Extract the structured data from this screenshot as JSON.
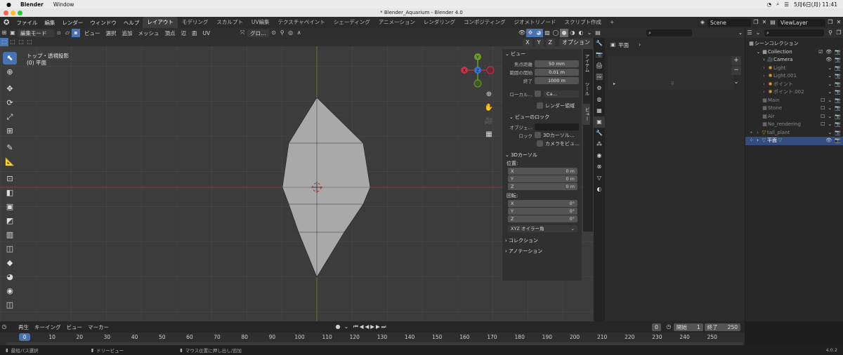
{
  "mac": {
    "app": "Blender",
    "menu": [
      "Window"
    ],
    "clock": "5月6日(月) 11:41"
  },
  "window": {
    "title": "* Blender_Aquarium - Blender 4.0"
  },
  "menubar": {
    "items": [
      "ファイル",
      "編集",
      "レンダー",
      "ウィンドウ",
      "ヘルプ"
    ],
    "workspaces": [
      "レイアウト",
      "モデリング",
      "スカルプト",
      "UV編集",
      "テクスチャペイント",
      "シェーディング",
      "アニメーション",
      "レンダリング",
      "コンポジティング",
      "ジオメトリノード",
      "スクリプト作成"
    ],
    "add_ws": "+",
    "scene": "Scene",
    "viewlayer": "ViewLayer"
  },
  "viewport": {
    "mode": "編集モード",
    "menus": [
      "ビュー",
      "選択",
      "追加",
      "メッシュ",
      "頂点",
      "辺",
      "面",
      "UV"
    ],
    "transform": "グロ…",
    "overlay_label": "オプション",
    "xyz": [
      "X",
      "Y",
      "Z"
    ],
    "info_line1": "トップ・透視投影",
    "info_line2": "(0) 平面",
    "gizmo": {
      "y": "Y",
      "x": "X",
      "z": "Z"
    }
  },
  "npanel": {
    "view_header": "ビュー",
    "focal_label": "焦点距離",
    "focal_value": "50 mm",
    "clip_start_label": "範囲の開始",
    "clip_start_value": "0.01 m",
    "clip_end_label": "終了",
    "clip_end_value": "1000 m",
    "local_label": "ローカル…",
    "local_value": "Ca…",
    "render_region": "レンダー領域",
    "lock_header": "ビューのロック",
    "obj_label": "オブジェ…",
    "lock_label": "ロック",
    "lock_3d": "3Dカーソル…",
    "lock_cam": "カメラをビュ…",
    "cursor_header": "3Dカーソル",
    "loc_label": "位置:",
    "loc": [
      {
        "axis": "X",
        "val": "0 m"
      },
      {
        "axis": "Y",
        "val": "0 m"
      },
      {
        "axis": "Z",
        "val": "0 m"
      }
    ],
    "rot_label": "回転:",
    "rot": [
      {
        "axis": "X",
        "val": "0°"
      },
      {
        "axis": "Y",
        "val": "0°"
      },
      {
        "axis": "Z",
        "val": "0°"
      }
    ],
    "rot_mode": "XYZ オイラー角",
    "collection_header": "コレクション",
    "annotation_header": "アノテーション",
    "tabs": [
      "アイテム",
      "ツール",
      "ビュー"
    ]
  },
  "properties": {
    "object": "平面"
  },
  "outliner": {
    "root": "シーンコレクション",
    "rows": [
      {
        "name": "Collection",
        "depth": 0
      },
      {
        "name": "Camera",
        "depth": 1
      },
      {
        "name": "Light",
        "depth": 1
      },
      {
        "name": "Light.001",
        "depth": 1
      },
      {
        "name": "ポイント",
        "depth": 1
      },
      {
        "name": "ポイント.002",
        "depth": 1
      },
      {
        "name": "Main",
        "depth": 0
      },
      {
        "name": "Stone",
        "depth": 0
      },
      {
        "name": "Air",
        "depth": 0
      },
      {
        "name": "No_rendering",
        "depth": 0
      },
      {
        "name": "tall_plant",
        "depth": 0
      },
      {
        "name": "平面",
        "depth": 0
      }
    ]
  },
  "timeline": {
    "menus": [
      "再生",
      "キーイング",
      "ビュー",
      "マーカー"
    ],
    "current": "0",
    "start_label": "開始",
    "start": "1",
    "end_label": "終了",
    "end": "250",
    "ticks": [
      "0",
      "10",
      "20",
      "30",
      "40",
      "50",
      "60",
      "70",
      "80",
      "90",
      "100",
      "110",
      "120",
      "130",
      "140",
      "150",
      "160",
      "170",
      "180",
      "190",
      "200",
      "210",
      "220",
      "230",
      "240",
      "250"
    ]
  },
  "status": {
    "left": "最短パス選択",
    "mid": "ドリービュー",
    "right": "マウス位置に押し出し/追加",
    "version": "4.0.2"
  }
}
